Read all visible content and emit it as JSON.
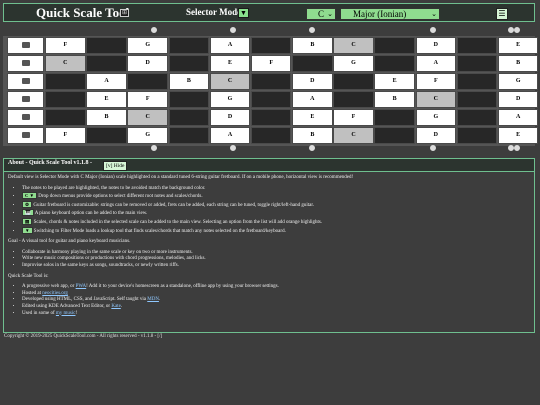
{
  "header": {
    "title": "Quick Scale Tool",
    "selector_mode_label": "Selector Mode",
    "mode_toggle_glyph": "▼",
    "root_note": "C",
    "scale": "Major (Ionian)",
    "menu_glyph": "☰"
  },
  "fretboard": {
    "top_markers": [
      "•",
      "•",
      "•",
      "•",
      "••"
    ],
    "bottom_markers": [
      "•",
      "•",
      "•",
      "•",
      "••"
    ],
    "strings": [
      [
        "F",
        "",
        "G",
        "",
        "A",
        "",
        "B",
        "C",
        "",
        "D",
        "",
        "E"
      ],
      [
        "C",
        "",
        "D",
        "",
        "E",
        "F",
        "",
        "G",
        "",
        "A",
        "",
        "B"
      ],
      [
        "",
        "A",
        "",
        "B",
        "C",
        "",
        "D",
        "",
        "E",
        "F",
        "",
        "G"
      ],
      [
        "",
        "E",
        "F",
        "",
        "G",
        "",
        "A",
        "",
        "B",
        "C",
        "",
        "D"
      ],
      [
        "",
        "B",
        "C",
        "",
        "D",
        "",
        "E",
        "F",
        "",
        "G",
        "",
        "A"
      ],
      [
        "F",
        "",
        "G",
        "",
        "A",
        "",
        "B",
        "C",
        "",
        "D",
        "",
        "E"
      ]
    ],
    "root_note": "C"
  },
  "about": {
    "title": "About - Quick Scale Tool v1.1.8 -",
    "hide_label": "[v] Hide",
    "intro": "Default view is Selector Mode with C Major (Ionian) scale highlighted on a standard tuned 6-string guitar fretboard. If on a mobile phone, horizontal view is recommended!",
    "features": [
      {
        "tag": "",
        "text": "The notes to be played are highlighted, the notes to be avoided match the background color."
      },
      {
        "tag": "C ▼",
        "text": "Drop down menus provide options to select different root notes and scales/chords."
      },
      {
        "tag": "⚙",
        "text": "Guitar fretboard is customizable: strings can be removed or added, frets can be added, each string can be tuned, toggle right/left-hand guitar."
      },
      {
        "tag": "🎹",
        "text": "A piano keyboard option can be added to the main view."
      },
      {
        "tag": "▤",
        "text": "Scales, chords & notes included in the selected scale can be added to the main view. Selecting an option from the list will add orange highlights."
      },
      {
        "tag": "▼",
        "text": "Switching to Filter Mode loads a lookup tool that finds scales/chords that match any notes selected on the fretboard/keyboard."
      }
    ],
    "goal": "Goal - A visual tool for guitar and piano keyboard musicians.",
    "goals": [
      "Collaborate in harmony playing in the same scale or key on two or more instruments.",
      "Write new music compositions or productions with chord progressions, melodies, and licks.",
      "Improvise solos in the same keys as songs, soundtracks, or newly written riffs."
    ],
    "is_label": "Quick Scale Tool is:",
    "is_items": [
      {
        "text": "A progressive web app, or ",
        "link": "PWA",
        "after": "! Add it to your device's homescreen as a standalone, offline app by using your browser settings."
      },
      {
        "text": "Hosted at ",
        "link": "neocities.org",
        "after": ""
      },
      {
        "text": "Developed using HTML, CSS, and JavaScript. Self taught via ",
        "link": "MDN",
        "after": "."
      },
      {
        "text": "Edited using KDE Advanced Text Editor, or ",
        "link": "Kate",
        "after": "."
      },
      {
        "text": "Used in some of ",
        "link": "my music",
        "after": "!"
      }
    ]
  },
  "footer": "Copyright © 2019-2025 QuickScaleTool.com - All rights reserved - v1.1.8 - [/]"
}
